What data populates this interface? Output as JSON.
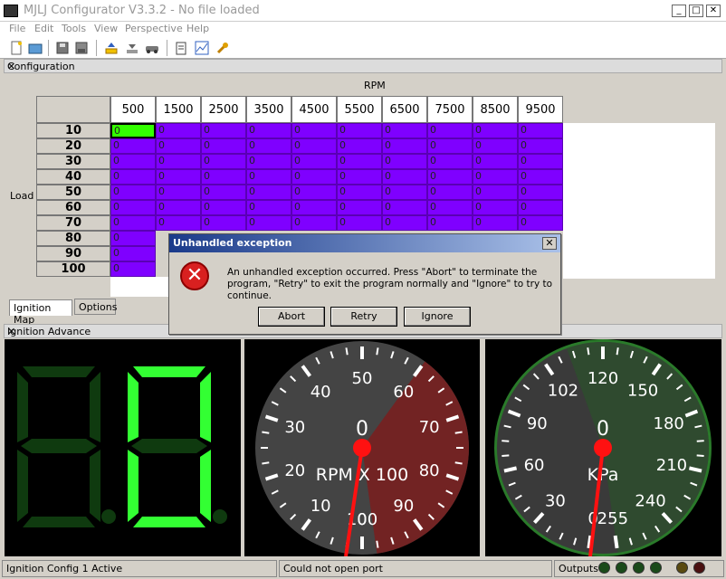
{
  "window": {
    "title": "MJLJ Configurator V3.3.2 - No file loaded",
    "min": "_",
    "max": "□",
    "close": "✕"
  },
  "menu": [
    "File",
    "Edit",
    "Tools",
    "View",
    "Perspective",
    "Help"
  ],
  "config_panel": {
    "title": "Configuration",
    "close": "✕",
    "column_axis_label": "RPM",
    "row_axis_label": "Load",
    "columns": [
      "500",
      "1500",
      "2500",
      "3500",
      "4500",
      "5500",
      "6500",
      "7500",
      "8500",
      "9500"
    ],
    "rows": [
      "10",
      "20",
      "30",
      "40",
      "50",
      "60",
      "70",
      "80",
      "90",
      "100"
    ],
    "cell_value": "0",
    "tabs": [
      "Ignition Map",
      "Options"
    ]
  },
  "advance_panel": {
    "title": "Ignition Advance",
    "close": "✕"
  },
  "rpm_gauge": {
    "label": "RPM X 100",
    "value": "0",
    "ticks": [
      "0",
      "10",
      "20",
      "30",
      "40",
      "50",
      "60",
      "70",
      "80",
      "90",
      "100"
    ]
  },
  "kpa_gauge": {
    "label": "KPa",
    "value": "0",
    "ticks": [
      "0",
      "30",
      "60",
      "90",
      "102",
      "120",
      "150",
      "180",
      "210",
      "240",
      "255"
    ]
  },
  "dialog": {
    "title": "Unhandled exception",
    "close": "✕",
    "message": "An unhandled exception occurred. Press \"Abort\" to terminate the program, \"Retry\" to exit the program normally and \"Ignore\" to try to continue.",
    "buttons": [
      "Abort",
      "Retry",
      "Ignore"
    ]
  },
  "status": {
    "config": "Ignition Config 1 Active",
    "port": "Could not open port",
    "outputs_label": "Outputs"
  },
  "colors": {
    "cell": "#7f00ff",
    "selected_cell": "#33ff00",
    "digit_on": "#33ff33",
    "digit_off": "#0f3a0f",
    "needle": "#ff1111"
  }
}
